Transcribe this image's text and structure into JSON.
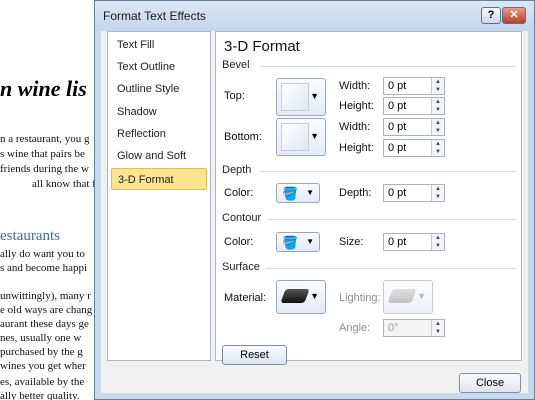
{
  "document": {
    "heading": "n wine lis",
    "lines": [
      "n a restaurant, you g",
      "s wine that pairs be",
      "friends during the w",
      "all know that feelin"
    ],
    "subheading": "estaurants",
    "lines2": [
      "ally do want you to",
      "s and become happi"
    ],
    "lines3": [
      "unwittingly), many r",
      "e old ways are chang",
      "aurant these days ge",
      "nes, usually one w",
      "purchased by the g",
      "wines you get wher"
    ],
    "lines4": [
      "es, available by the",
      "ally better quality."
    ]
  },
  "dialog": {
    "title": "Format Text Effects",
    "help_label": "?",
    "close_label": "✕",
    "nav_items": [
      "Text Fill",
      "Text Outline",
      "Outline Style",
      "Shadow",
      "Reflection",
      "Glow and Soft Edges",
      "3-D Format"
    ],
    "panel_title": "3-D Format",
    "bevel": {
      "section": "Bevel",
      "top_label": "Top:",
      "bottom_label": "Bottom:",
      "width_label": "Width:",
      "height_label": "Height:",
      "top_width": "0 pt",
      "top_height": "0 pt",
      "bottom_width": "0 pt",
      "bottom_height": "0 pt"
    },
    "depth": {
      "section": "Depth",
      "color_label": "Color:",
      "depth_label": "Depth:",
      "depth_value": "0 pt"
    },
    "contour": {
      "section": "Contour",
      "color_label": "Color:",
      "size_label": "Size:",
      "size_value": "0 pt"
    },
    "surface": {
      "section": "Surface",
      "material_label": "Material:",
      "lighting_label": "Lighting:",
      "angle_label": "Angle:",
      "angle_value": "0°"
    },
    "reset_label": "Reset",
    "close_button_label": "Close",
    "selected_nav": "3-D Format",
    "icons": {
      "dropdown_arrow": "▼",
      "spin_up": "▲",
      "spin_down": "▼",
      "paint_bucket": "🪣"
    }
  }
}
